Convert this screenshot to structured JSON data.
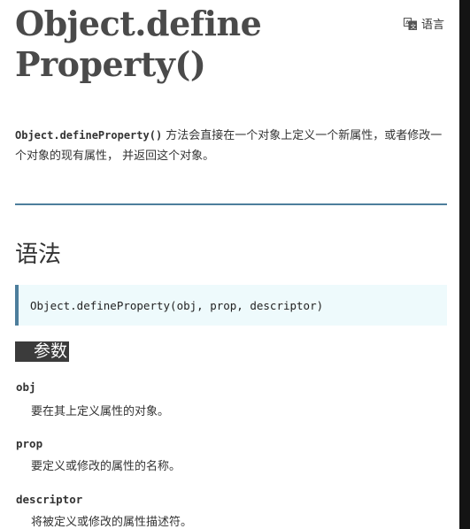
{
  "header": {
    "title_line1": "Object.define",
    "title_line2": "Property()",
    "language_label": "语言",
    "language_icon": "translate-icon"
  },
  "intro": {
    "code": "Object.defineProperty()",
    "text": " 方法会直接在一个对象上定义一个新属性，或者修改一个对象的现有属性， 并返回这个对象。"
  },
  "syntax": {
    "heading": "语法",
    "signature": "Object.defineProperty(obj, prop, descriptor)"
  },
  "parameters": {
    "heading": "参数",
    "items": [
      {
        "name": "obj",
        "desc": "要在其上定义属性的对象。"
      },
      {
        "name": "prop",
        "desc": "要定义或修改的属性的名称。"
      },
      {
        "name": "descriptor",
        "desc": "将被定义或修改的属性描述符。"
      }
    ]
  },
  "colors": {
    "accent": "#4d7e9c",
    "code_bg": "#eefafc",
    "heading_badge_bg": "#3b3b3b"
  }
}
